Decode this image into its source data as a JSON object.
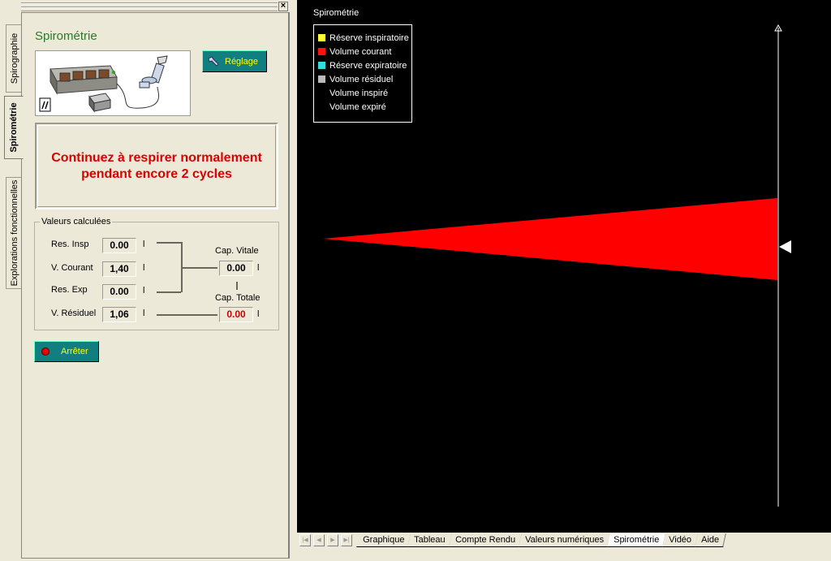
{
  "left_tabs": [
    "Spirographie",
    "Spirométrie",
    "Explorations fonctionnelles"
  ],
  "panel": {
    "title": "Spirométrie",
    "reglage_label": "Réglage",
    "message_line1": "Continuez à respirer normalement",
    "message_line2": "pendant encore 2 cycles",
    "arreter_label": "Arrêter"
  },
  "values": {
    "legend": "Valeurs calculées",
    "unit": "l",
    "rows": [
      {
        "label": "Res. Insp",
        "value": "0.00"
      },
      {
        "label": "V. Courant",
        "value": "1,40"
      },
      {
        "label": "Res. Exp",
        "value": "0.00"
      },
      {
        "label": "V. Résiduel",
        "value": "1,06"
      }
    ],
    "cap_vitale": {
      "label": "Cap. Vitale",
      "value": "0.00"
    },
    "cap_totale": {
      "label": "Cap. Totale",
      "value": "0.00"
    }
  },
  "chart": {
    "title": "Spirométrie",
    "legend": [
      {
        "label": "Réserve inspiratoire",
        "color": "#ffff33"
      },
      {
        "label": "Volume courant",
        "color": "#ff1111"
      },
      {
        "label": "Réserve expiratoire",
        "color": "#33dddd"
      },
      {
        "label": "Volume résiduel",
        "color": "#bbbbbb"
      },
      {
        "label": "Volume inspiré",
        "color": ""
      },
      {
        "label": "Volume expiré",
        "color": ""
      }
    ],
    "wedge_color": "#ff0000"
  },
  "bottom_tabs": {
    "items": [
      "Graphique",
      "Tableau",
      "Compte Rendu",
      "Valeurs numériques",
      "Spirométrie",
      "Vidéo",
      "Aide"
    ],
    "active": "Spirométrie"
  }
}
